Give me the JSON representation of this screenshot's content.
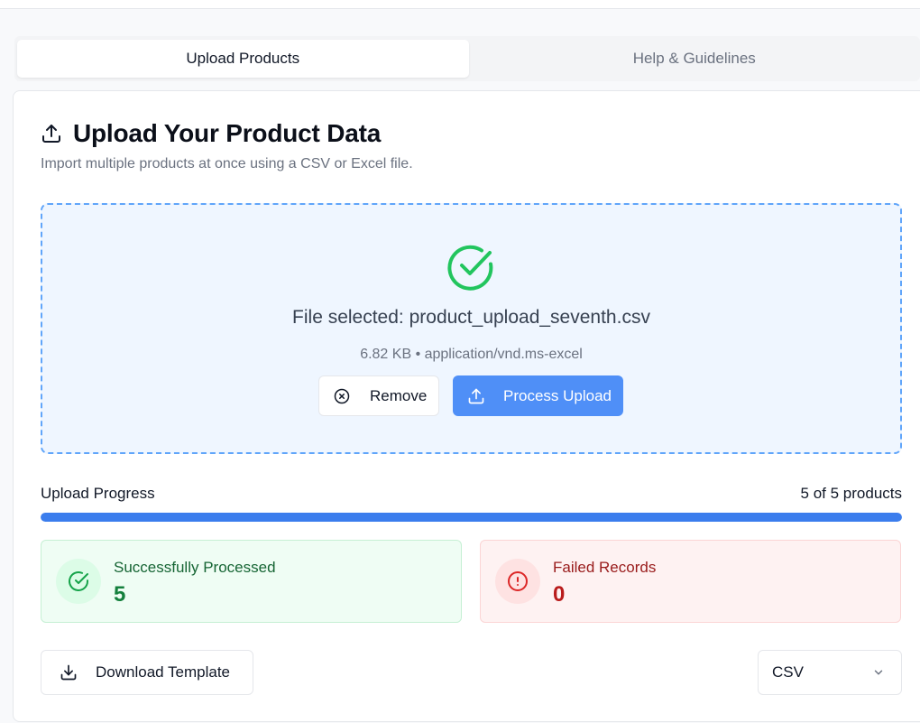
{
  "tabs": [
    {
      "label": "Upload Products",
      "active": true
    },
    {
      "label": "Help & Guidelines",
      "active": false
    }
  ],
  "header": {
    "title": "Upload Your Product Data",
    "subtitle": "Import multiple products at once using a CSV or Excel file.",
    "icon": "upload-icon"
  },
  "dropzone": {
    "status_icon": "check-circle-icon",
    "file_selected": "File selected: product_upload_seventh.csv",
    "file_meta": "6.82 KB • application/vnd.ms-excel",
    "remove_label": "Remove",
    "process_label": "Process Upload"
  },
  "progress": {
    "label": "Upload Progress",
    "count_text": "5 of 5 products",
    "fraction": 1.0
  },
  "stats": {
    "success": {
      "label": "Successfully Processed",
      "value": "5",
      "icon": "check-circle-icon"
    },
    "failed": {
      "label": "Failed Records",
      "value": "0",
      "icon": "alert-circle-icon"
    }
  },
  "footer": {
    "download_label": "Download Template",
    "format_selected": "CSV"
  },
  "colors": {
    "accent": "#4f8ff7",
    "progress": "#3b7ded",
    "success": "#22c55e",
    "danger": "#dc2626"
  }
}
